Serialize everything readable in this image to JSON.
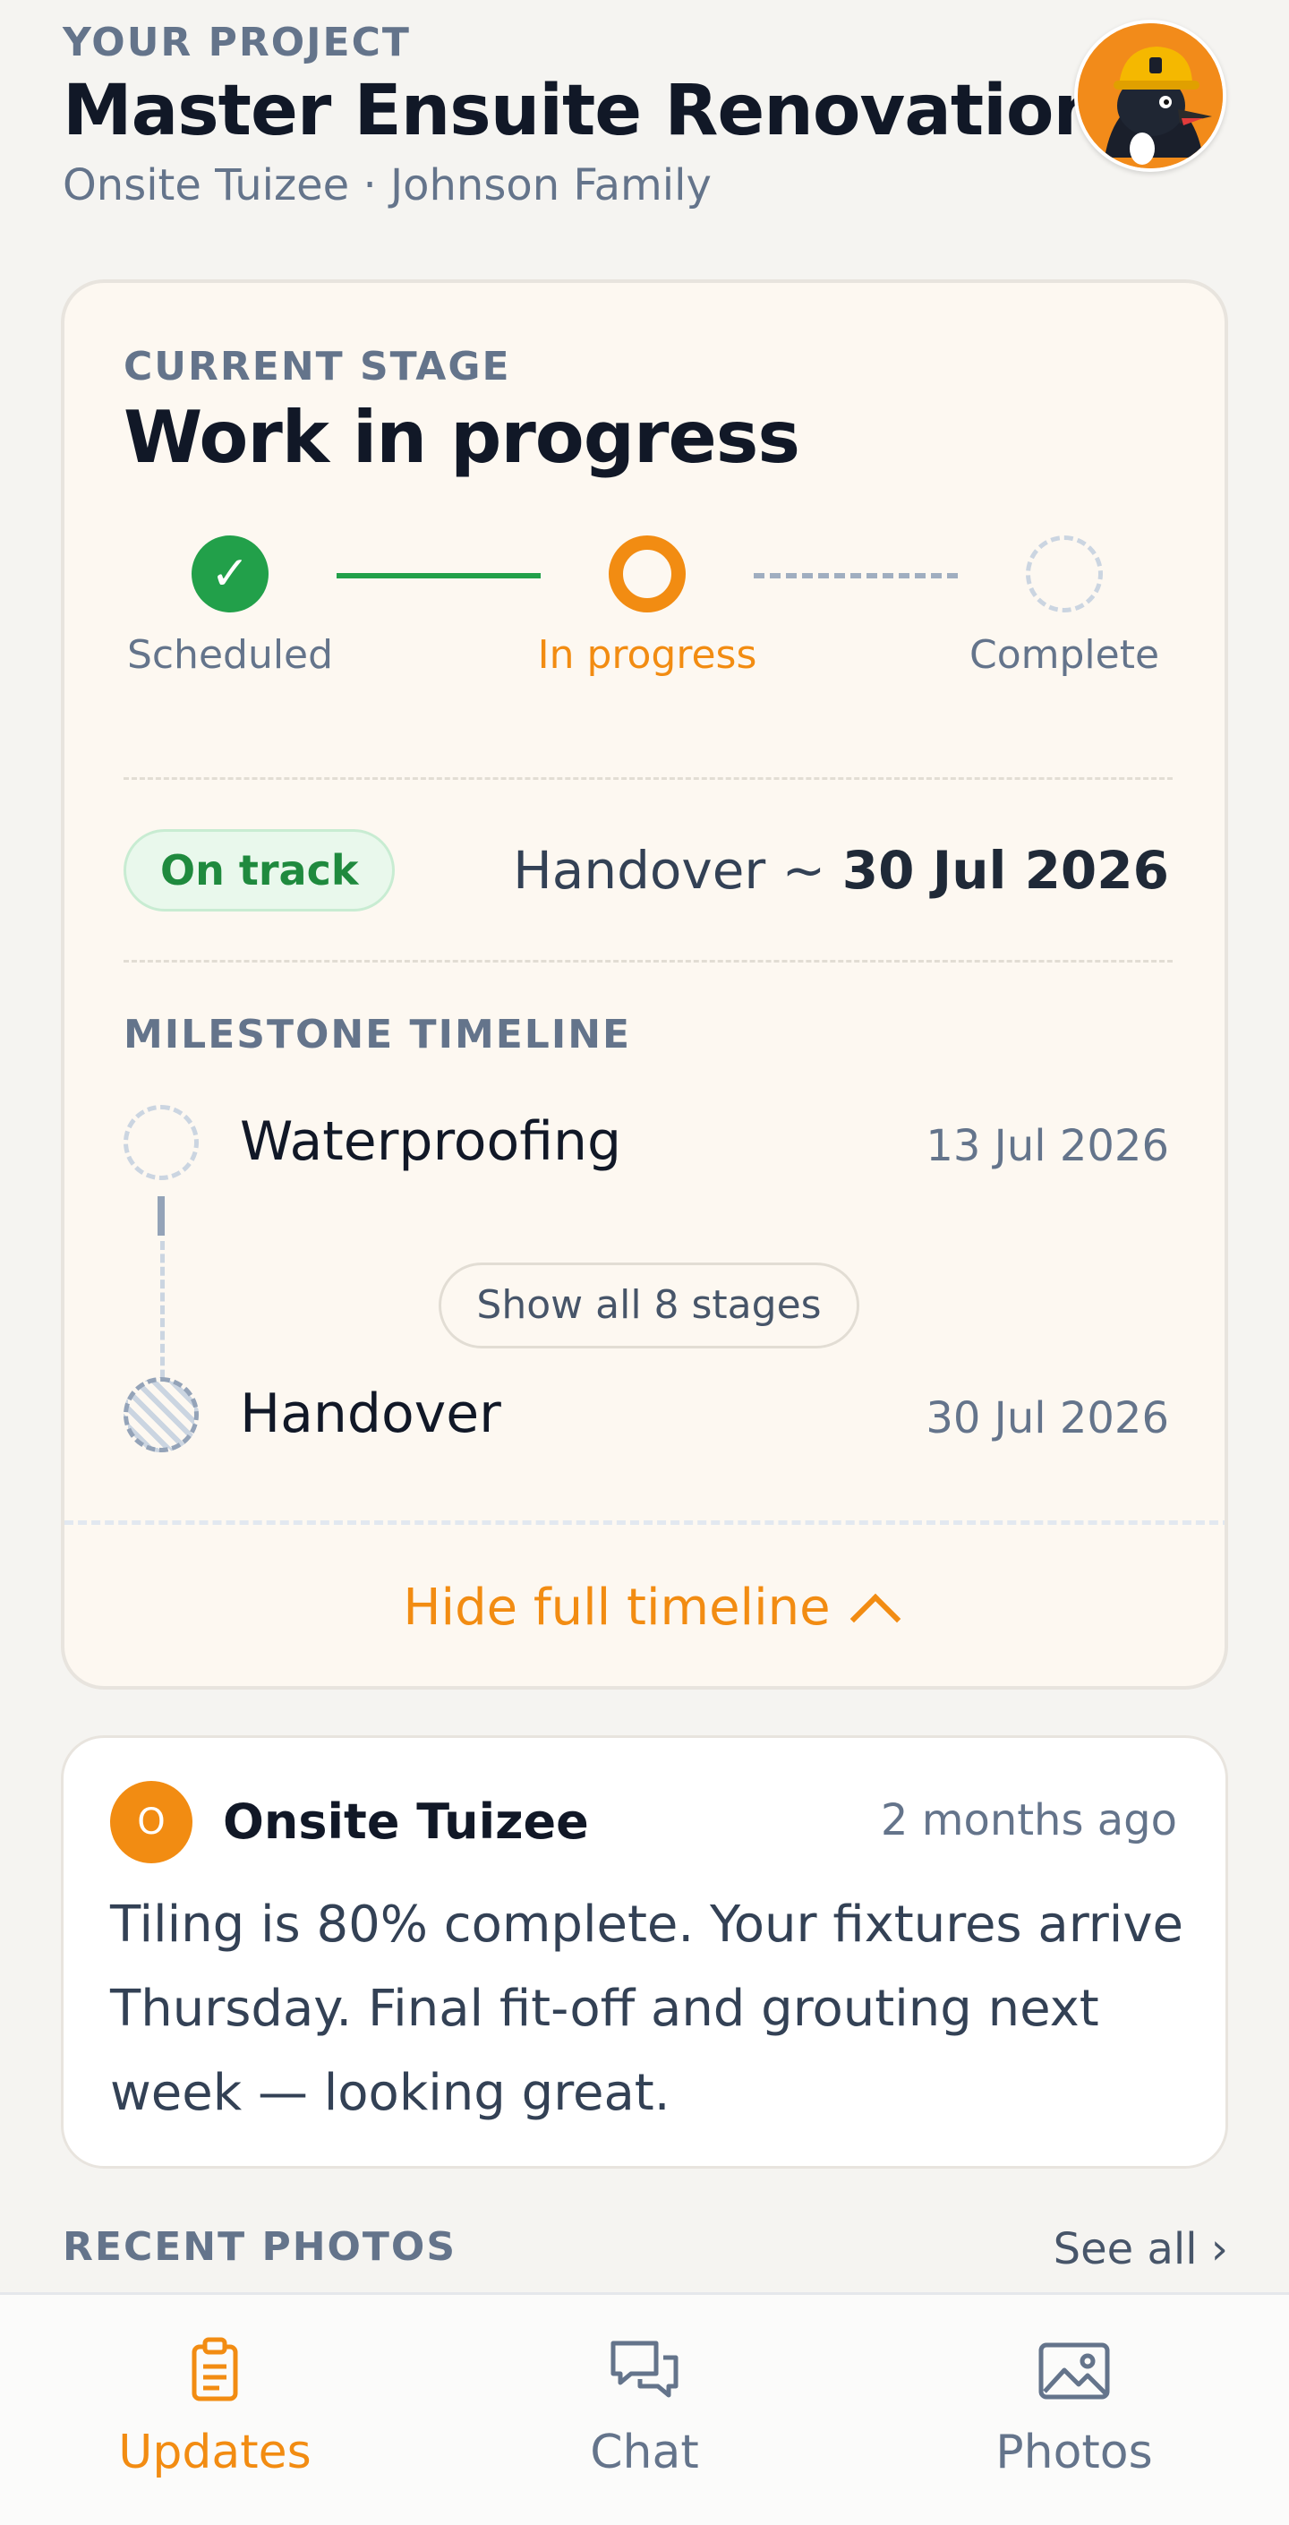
{
  "header": {
    "eyebrow": "YOUR PROJECT",
    "title": "Master Ensuite Renovation",
    "subtitle": "Onsite Tuizee · Johnson Family",
    "avatar_icon": "bird-builder-avatar"
  },
  "stage_card": {
    "eyebrow": "CURRENT STAGE",
    "title": "Work in progress",
    "steps": [
      {
        "label": "Scheduled",
        "state": "done"
      },
      {
        "label": "In progress",
        "state": "current"
      },
      {
        "label": "Complete",
        "state": "todo"
      }
    ],
    "status_badge": "On track",
    "handover_prefix": "Handover ~ ",
    "handover_date": "30 Jul 2026",
    "milestone_eyebrow": "MILESTONE TIMELINE",
    "milestones": [
      {
        "name": "Waterproofing",
        "date": "13 Jul 2026"
      },
      {
        "name": "Handover",
        "date": "30 Jul 2026"
      }
    ],
    "show_all_label": "Show all 8 stages",
    "hide_label": "Hide full timeline"
  },
  "update": {
    "avatar_initial": "O",
    "author": "Onsite Tuizee",
    "time": "2 months ago",
    "body": "Tiling is 80% complete. Your fixtures arrive Thursday. Final fit-off and grouting next week — looking great."
  },
  "photos": {
    "label": "RECENT PHOTOS",
    "see_all": "See all ›"
  },
  "nav": {
    "items": [
      {
        "label": "Updates",
        "icon": "clipboard-icon",
        "active": true
      },
      {
        "label": "Chat",
        "icon": "chat-bubbles-icon",
        "active": false
      },
      {
        "label": "Photos",
        "icon": "image-icon",
        "active": false
      }
    ]
  },
  "colors": {
    "accent": "#f28c12",
    "success": "#22a04a",
    "text": "#111827",
    "muted": "#64748b"
  }
}
